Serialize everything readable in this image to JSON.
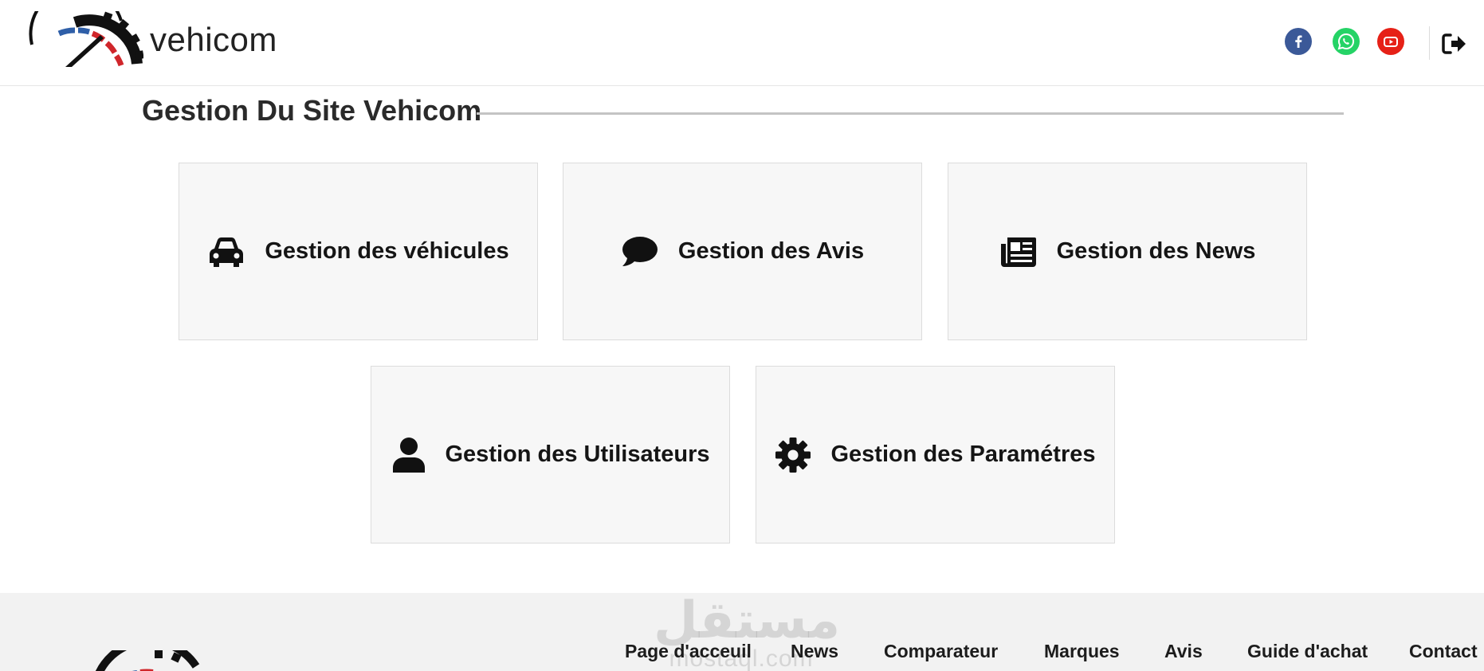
{
  "header": {
    "brand": "vehicom",
    "social": [
      {
        "icon": "facebook-icon",
        "color": "#3b5998"
      },
      {
        "icon": "whatsapp-icon",
        "color": "#25d366"
      },
      {
        "icon": "youtube-icon",
        "color": "#e62117"
      }
    ],
    "logout_icon": "sign-out-icon"
  },
  "main": {
    "title": "Gestion Du Site Vehicom",
    "cards": [
      {
        "label": "Gestion des véhicules",
        "icon": "car-icon"
      },
      {
        "label": "Gestion des Avis",
        "icon": "comment-icon"
      },
      {
        "label": "Gestion des News",
        "icon": "newspaper-icon"
      },
      {
        "label": "Gestion des Utilisateurs",
        "icon": "user-icon"
      },
      {
        "label": "Gestion des Paramétres",
        "icon": "gear-icon"
      }
    ]
  },
  "footer": {
    "nav": [
      "Page d'acceuil",
      "News",
      "Comparateur",
      "Marques",
      "Avis",
      "Guide d'achat",
      "Contact"
    ],
    "watermark": {
      "arabic": "مستقل",
      "latin": "mostaql.com"
    }
  },
  "colors": {
    "card_bg": "#f7f7f7",
    "footer_bg": "#f2f2f2",
    "logo_red": "#d0262b",
    "logo_blue": "#2f5fa8"
  }
}
